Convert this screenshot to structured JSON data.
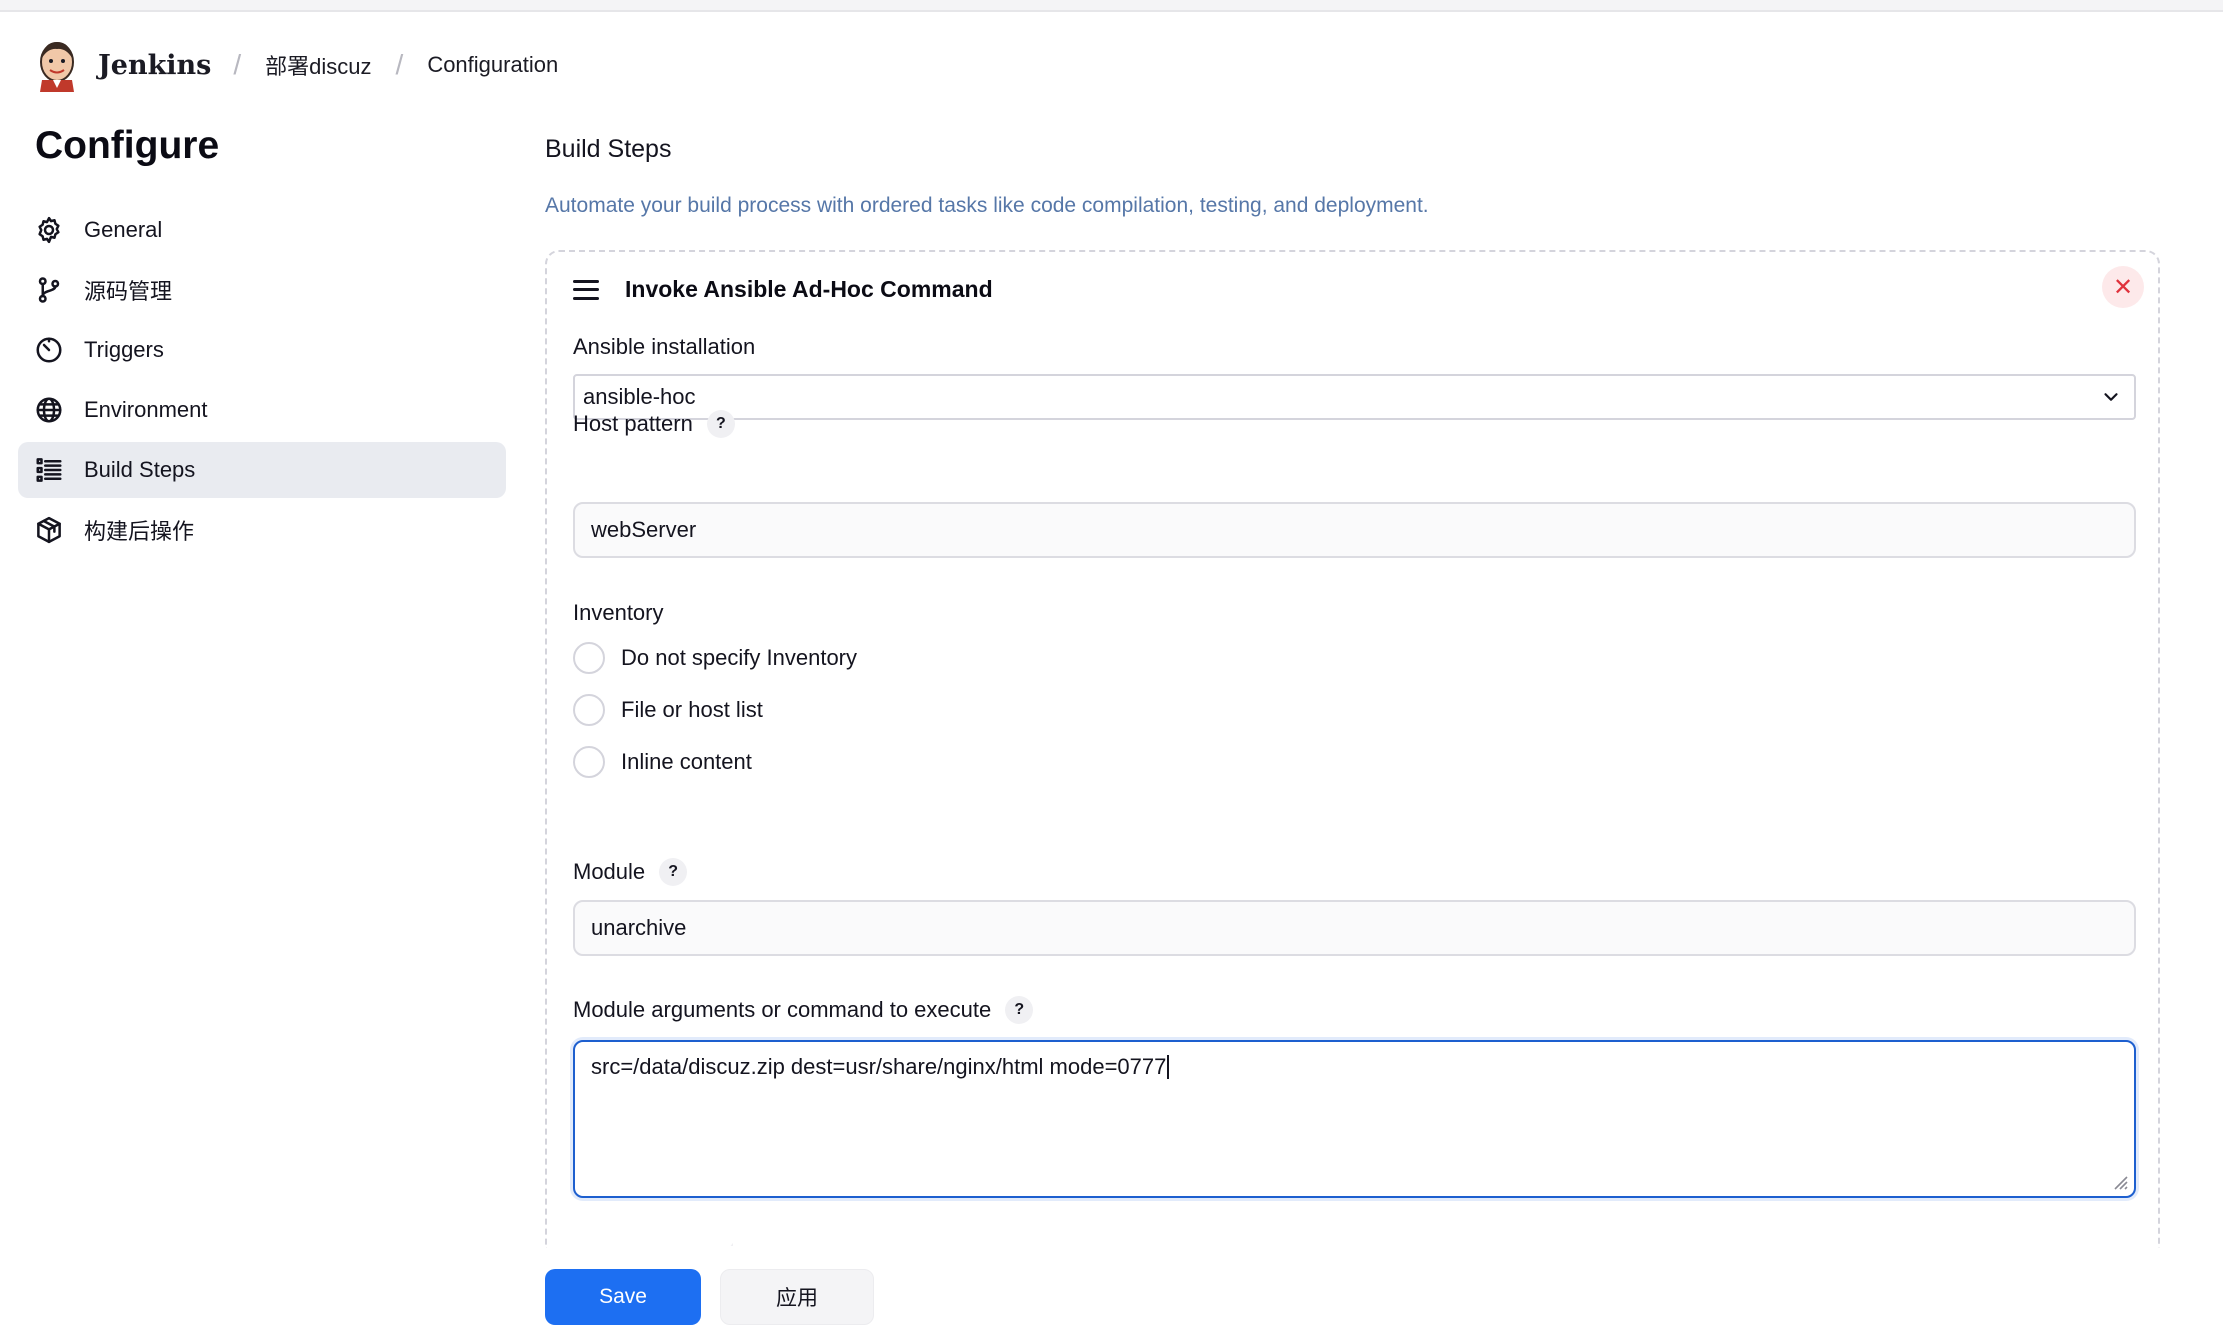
{
  "header": {
    "brand": "Jenkins",
    "breadcrumbs": [
      "部署discuz",
      "Configuration"
    ]
  },
  "sidebar": {
    "title": "Configure",
    "items": [
      {
        "label": "General",
        "icon": "gear-icon"
      },
      {
        "label": "源码管理",
        "icon": "branch-icon"
      },
      {
        "label": "Triggers",
        "icon": "clock-icon"
      },
      {
        "label": "Environment",
        "icon": "globe-icon"
      },
      {
        "label": "Build Steps",
        "icon": "list-icon",
        "active": true
      },
      {
        "label": "构建后操作",
        "icon": "package-icon"
      }
    ]
  },
  "main": {
    "section_title": "Build Steps",
    "section_description": "Automate your build process with ordered tasks like code compilation, testing, and deployment.",
    "step": {
      "title": "Invoke Ansible Ad-Hoc Command",
      "ansible_installation_label": "Ansible installation",
      "ansible_installation_value": "ansible-hoc",
      "host_pattern_label": "Host pattern",
      "host_pattern_value": "webServer",
      "inventory_label": "Inventory",
      "inventory_options": [
        "Do not specify Inventory",
        "File or host list",
        "Inline content"
      ],
      "module_label": "Module",
      "module_value": "unarchive",
      "module_args_label": "Module arguments or command to execute",
      "module_args_value": "src=/data/discuz.zip dest=usr/share/nginx/html mode=0777",
      "help_glyph": "?"
    }
  },
  "footer": {
    "save_label": "Save",
    "apply_label": "应用"
  },
  "colors": {
    "accent": "#1d6ff2",
    "description": "#5677a8",
    "close": "#e0323c"
  }
}
